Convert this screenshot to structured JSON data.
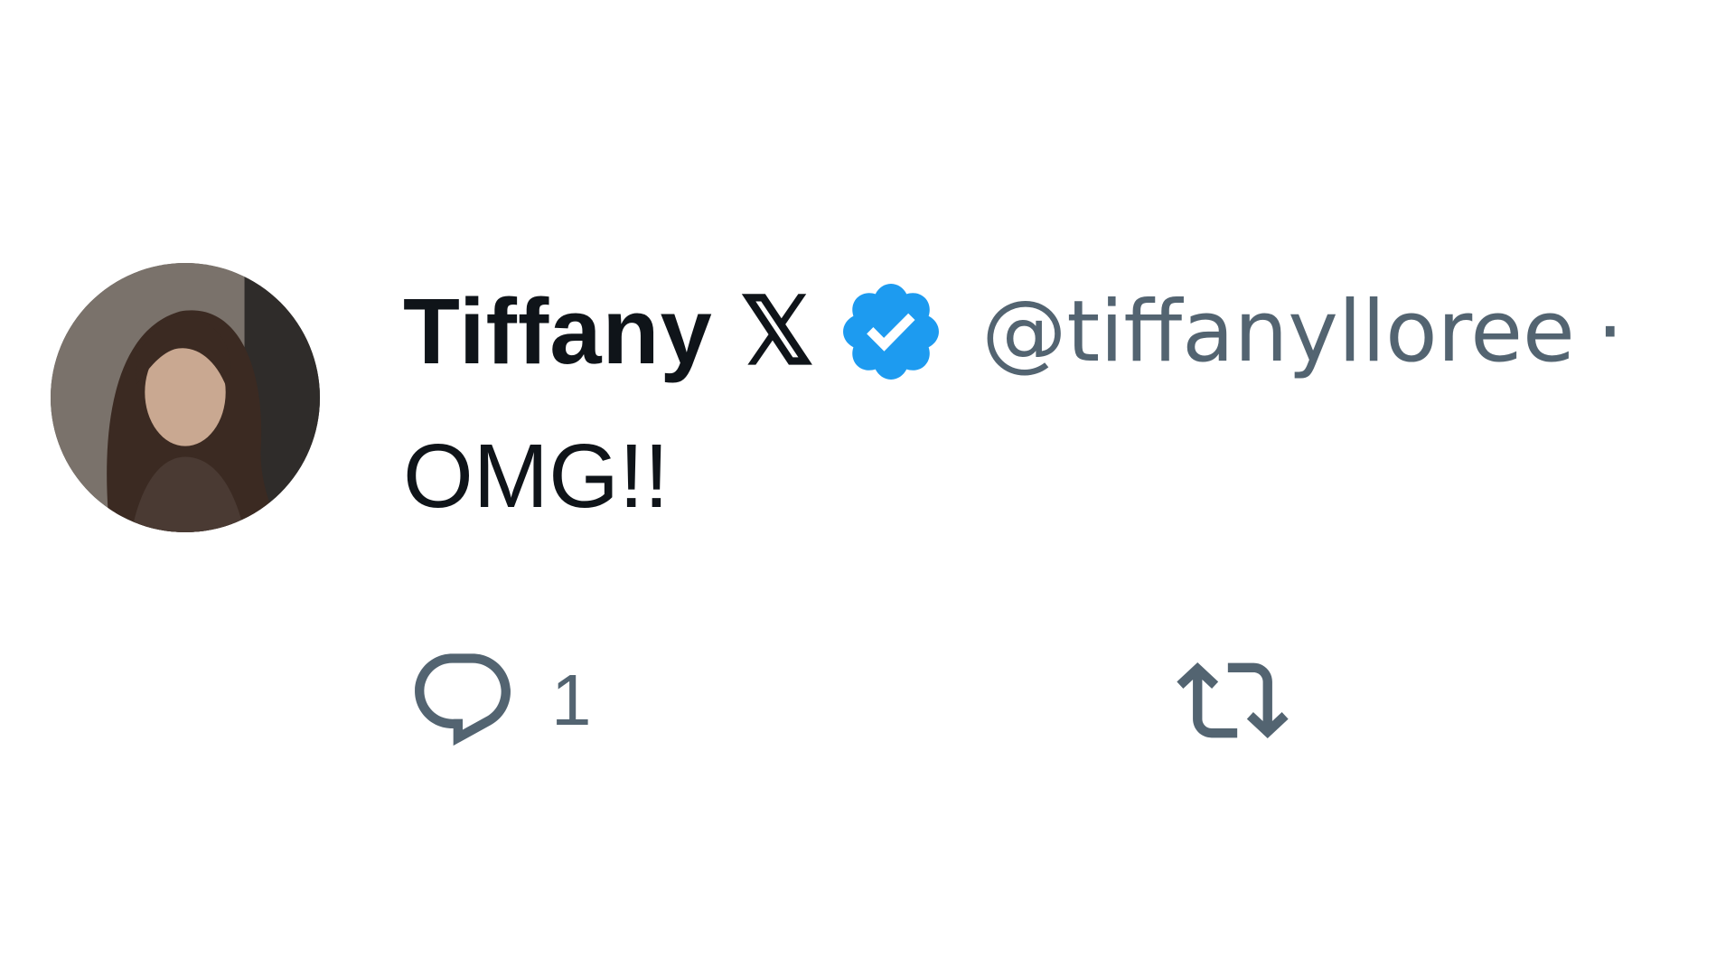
{
  "tweet": {
    "author": {
      "display_name": "Tiffany 𝕏",
      "handle": "@tiffanylloree",
      "separator": "·",
      "avatar_icon": "profile-photo",
      "verified_icon": "verified-badge-icon",
      "verified_color": "#1d9bf0"
    },
    "text": "OMG!!",
    "actions": {
      "reply_icon": "reply-icon",
      "reply_count": "1",
      "retweet_icon": "retweet-icon"
    }
  },
  "colors": {
    "primary_text": "#0f1419",
    "secondary_text": "#536471",
    "background": "#ffffff"
  }
}
